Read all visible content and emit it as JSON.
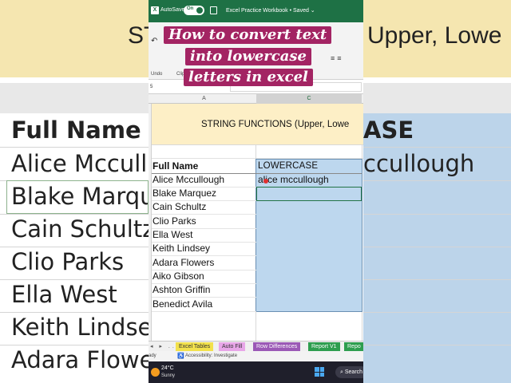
{
  "background": {
    "title_fragment_left": "STR",
    "title_fragment_right": "Upper, Lowe",
    "header_left": "Full Name",
    "header_right": "ASE",
    "rows_left": [
      "Alice Mccullo",
      "Blake Marqu",
      "Cain Schultz",
      "Clio Parks",
      "Ella West",
      "Keith Lindse",
      "Adara Flowe"
    ],
    "row_right": "ccullough"
  },
  "titlebar": {
    "app_icon": "X",
    "autosave_label": "AutoSave",
    "autosave_state": "On",
    "document_title": "Excel Practice Workbook • Saved ⌄"
  },
  "ribbon": {
    "undo_group_label": "Undo",
    "clipboard_group_label": "Clip"
  },
  "formula_bar": {
    "name_box": "5"
  },
  "column_headers": {
    "a": "A",
    "c": "C"
  },
  "sheet": {
    "banner_title": "STRING FUNCTIONS (Upper, Lowe",
    "header_a": "Full Name",
    "header_c": "LOWERCASE",
    "names": [
      "Alice Mccullough",
      "Blake Marquez",
      "Cain Schultz",
      "Clio Parks",
      "Ella West",
      "Keith Lindsey",
      "Adara Flowers",
      "Aiko Gibson",
      "Ashton Griffin",
      "Benedict Avila"
    ],
    "lowercase_values": [
      "alice mccullough"
    ]
  },
  "sheet_tabs": {
    "nav": "◂ ▸ ...",
    "tabs": [
      {
        "label": "Excel Tables",
        "color": "#f2e14c"
      },
      {
        "label": "Auto Fill",
        "color": "#e8a6e8"
      },
      {
        "label": "Row Differences",
        "color": "#9b59b6"
      },
      {
        "label": "Report V1",
        "color": "#2e9e4f"
      },
      {
        "label": "Repo",
        "color": "#2e9e4f"
      }
    ]
  },
  "status_bar": {
    "ready": "ady",
    "accessibility": "Accessibility: Investigate"
  },
  "taskbar": {
    "temperature": "24°C",
    "condition": "Sunny",
    "search_label": "⌕ Search"
  },
  "caption": {
    "lines": [
      "How to convert text",
      "into lowercase",
      "letters in excel"
    ],
    "color": "#a32463"
  }
}
